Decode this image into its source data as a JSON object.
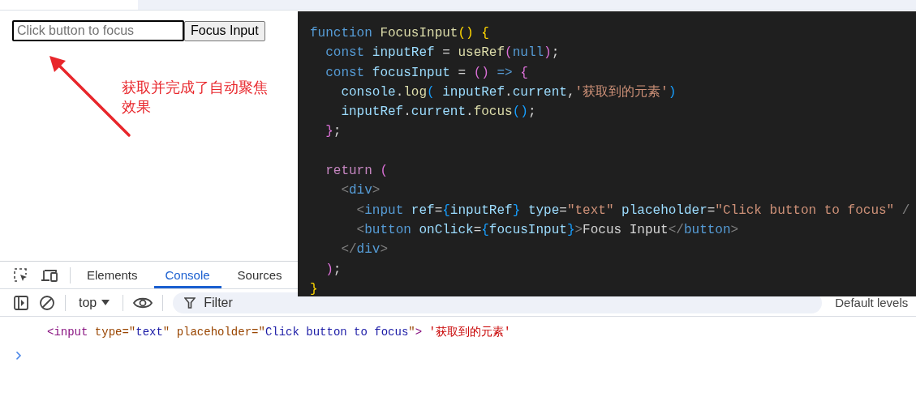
{
  "page": {
    "input": {
      "placeholder": "Click button to focus",
      "focused": true
    },
    "button": "Focus Input",
    "annotation": "获取并完成了自动聚焦效果"
  },
  "code_editor": {
    "lines": [
      {
        "kind": "code",
        "tokens": [
          {
            "t": "function",
            "kind": "kw"
          },
          {
            "t": " FocusInput",
            "kind": "fn"
          },
          {
            "t": "()",
            "kind": "b1"
          },
          {
            "t": " {",
            "kind": "b1"
          }
        ]
      },
      {
        "kind": "code",
        "tokens": [
          {
            "t": "  const",
            "kind": "kw"
          },
          {
            "t": " inputRef",
            "kind": "var"
          },
          {
            "t": " =",
            "kind": "p"
          },
          {
            "t": " useRef",
            "kind": "fn"
          },
          {
            "t": "(",
            "kind": "b2"
          },
          {
            "t": "null",
            "kind": "kw"
          },
          {
            "t": ")",
            "kind": "b2"
          },
          {
            "t": ";",
            "kind": "p"
          }
        ]
      },
      {
        "kind": "code",
        "tokens": [
          {
            "t": "  const",
            "kind": "kw"
          },
          {
            "t": " focusInput",
            "kind": "var"
          },
          {
            "t": " =",
            "kind": "p"
          },
          {
            "t": " ()",
            "kind": "b2"
          },
          {
            "t": " =>",
            "kind": "kw"
          },
          {
            "t": " {",
            "kind": "b2"
          }
        ]
      },
      {
        "kind": "code",
        "tokens": [
          {
            "t": "    console",
            "kind": "var"
          },
          {
            "t": ".",
            "kind": "p"
          },
          {
            "t": "log",
            "kind": "fn"
          },
          {
            "t": "(",
            "kind": "b3"
          },
          {
            "t": " inputRef",
            "kind": "var"
          },
          {
            "t": ".",
            "kind": "p"
          },
          {
            "t": "current",
            "kind": "var"
          },
          {
            "t": ",",
            "kind": "p"
          },
          {
            "t": "'获取到的元素'",
            "kind": "str"
          },
          {
            "t": ")",
            "kind": "b3"
          }
        ]
      },
      {
        "kind": "code",
        "tokens": [
          {
            "t": "    inputRef",
            "kind": "var"
          },
          {
            "t": ".",
            "kind": "p"
          },
          {
            "t": "current",
            "kind": "var"
          },
          {
            "t": ".",
            "kind": "p"
          },
          {
            "t": "focus",
            "kind": "fn"
          },
          {
            "t": "()",
            "kind": "b3"
          },
          {
            "t": ";",
            "kind": "p"
          }
        ]
      },
      {
        "kind": "code",
        "tokens": [
          {
            "t": "  }",
            "kind": "b2"
          },
          {
            "t": ";",
            "kind": "p"
          }
        ]
      },
      {
        "kind": "blank"
      },
      {
        "kind": "code",
        "tokens": [
          {
            "t": "  return",
            "kind": "ctl"
          },
          {
            "t": " (",
            "kind": "b2"
          }
        ]
      },
      {
        "kind": "code",
        "tokens": [
          {
            "t": "    <",
            "kind": "ang"
          },
          {
            "t": "div",
            "kind": "tag"
          },
          {
            "t": ">",
            "kind": "ang"
          }
        ]
      },
      {
        "kind": "code",
        "tokens": [
          {
            "t": "      <",
            "kind": "ang"
          },
          {
            "t": "input",
            "kind": "tag"
          },
          {
            "t": " ref",
            "kind": "attr"
          },
          {
            "t": "=",
            "kind": "p"
          },
          {
            "t": "{",
            "kind": "b3"
          },
          {
            "t": "inputRef",
            "kind": "var"
          },
          {
            "t": "}",
            "kind": "b3"
          },
          {
            "t": " type",
            "kind": "attr"
          },
          {
            "t": "=",
            "kind": "p"
          },
          {
            "t": "\"text\"",
            "kind": "str"
          },
          {
            "t": " placeholder",
            "kind": "attr"
          },
          {
            "t": "=",
            "kind": "p"
          },
          {
            "t": "\"Click button to focus\"",
            "kind": "str"
          },
          {
            "t": " /",
            "kind": "ang"
          }
        ]
      },
      {
        "kind": "code",
        "tokens": [
          {
            "t": "      <",
            "kind": "ang"
          },
          {
            "t": "button",
            "kind": "tag"
          },
          {
            "t": " onClick",
            "kind": "attr"
          },
          {
            "t": "=",
            "kind": "p"
          },
          {
            "t": "{",
            "kind": "b3"
          },
          {
            "t": "focusInput",
            "kind": "var"
          },
          {
            "t": "}",
            "kind": "b3"
          },
          {
            "t": ">",
            "kind": "ang"
          },
          {
            "t": "Focus Input",
            "kind": "p"
          },
          {
            "t": "</",
            "kind": "ang"
          },
          {
            "t": "button",
            "kind": "tag"
          },
          {
            "t": ">",
            "kind": "ang"
          }
        ]
      },
      {
        "kind": "code",
        "tokens": [
          {
            "t": "    </",
            "kind": "ang"
          },
          {
            "t": "div",
            "kind": "tag"
          },
          {
            "t": ">",
            "kind": "ang"
          }
        ]
      },
      {
        "kind": "code",
        "tokens": [
          {
            "t": "  )",
            "kind": "b2"
          },
          {
            "t": ";",
            "kind": "p"
          }
        ]
      },
      {
        "kind": "code",
        "tokens": [
          {
            "t": "}",
            "kind": "b1"
          }
        ]
      }
    ]
  },
  "devtools": {
    "tabs": [
      {
        "label": "Elements",
        "selected": false
      },
      {
        "label": "Console",
        "selected": true
      },
      {
        "label": "Sources",
        "selected": false
      }
    ],
    "context": "top",
    "filter": {
      "placeholder": "Filter"
    },
    "levels": "Default levels",
    "console": {
      "entries": [
        {
          "tokens": [
            {
              "t": "<input",
              "kind": "ctag"
            },
            {
              "t": " type=\"",
              "kind": "cattr"
            },
            {
              "t": "text",
              "kind": "cval"
            },
            {
              "t": "\"",
              "kind": "cattr"
            },
            {
              "t": " placeholder=\"",
              "kind": "cattr"
            },
            {
              "t": "Click button to focus",
              "kind": "cval"
            },
            {
              "t": "\"",
              "kind": "cattr"
            },
            {
              "t": ">",
              "kind": "ctag"
            },
            {
              "t": " '获取到的元素'",
              "kind": "cstr"
            }
          ]
        }
      ]
    }
  }
}
